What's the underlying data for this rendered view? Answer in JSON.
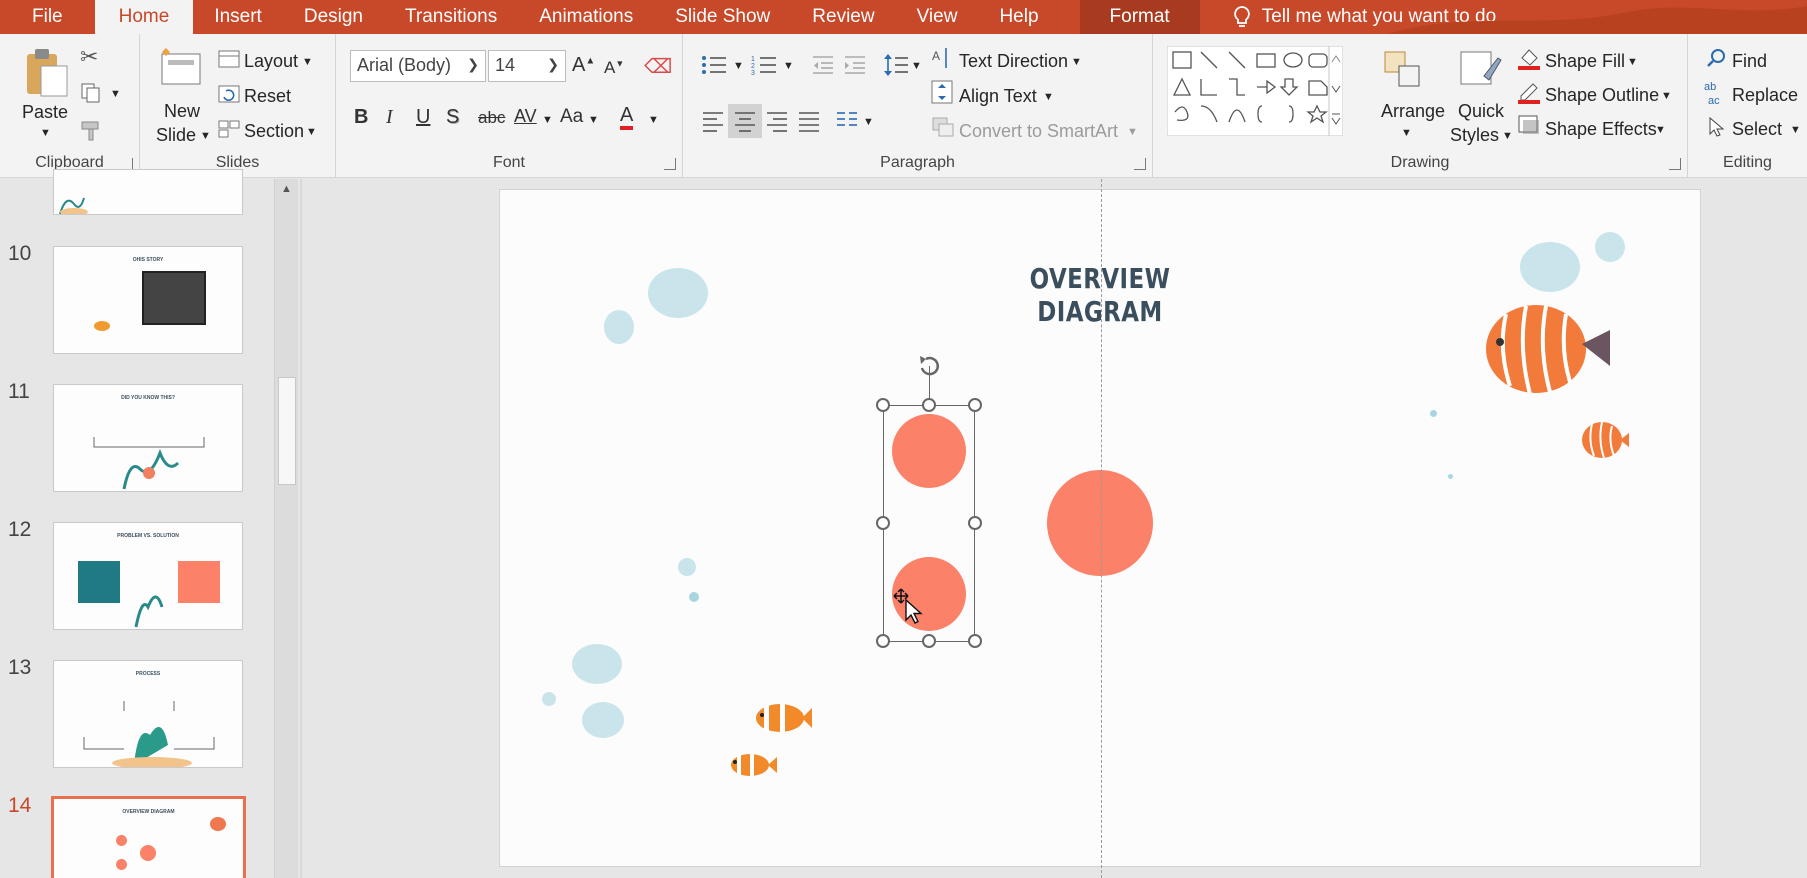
{
  "tabs": [
    "File",
    "Home",
    "Insert",
    "Design",
    "Transitions",
    "Animations",
    "Slide Show",
    "Review",
    "View",
    "Help"
  ],
  "active_tab": "Home",
  "context_tab": "Format",
  "tell_me": "Tell me what you want to do",
  "ribbon": {
    "clipboard": {
      "label": "Clipboard",
      "paste": "Paste"
    },
    "slides": {
      "label": "Slides",
      "new_slide_line1": "New",
      "new_slide_line2": "Slide",
      "layout": "Layout",
      "reset": "Reset",
      "section": "Section"
    },
    "font": {
      "label": "Font",
      "font_name": "Arial (Body)",
      "font_size": "14",
      "bold": "B",
      "italic": "I",
      "underline": "U",
      "shadow": "S",
      "strike": "abc",
      "spacing": "AV",
      "case": "Aa",
      "color": "A"
    },
    "paragraph": {
      "label": "Paragraph",
      "text_direction": "Text Direction",
      "align_text": "Align Text",
      "convert_smartart": "Convert to SmartArt"
    },
    "drawing": {
      "label": "Drawing",
      "arrange": "Arrange",
      "quick_styles_line1": "Quick",
      "quick_styles_line2": "Styles",
      "shape_fill": "Shape Fill",
      "shape_outline": "Shape Outline",
      "shape_effects": "Shape Effects"
    },
    "editing": {
      "label": "Editing",
      "find": "Find",
      "replace": "Replace",
      "select": "Select"
    }
  },
  "thumbnails": [
    {
      "number": "10",
      "title": "OHIS STORY"
    },
    {
      "number": "11",
      "title": "DID YOU KNOW THIS?"
    },
    {
      "number": "12",
      "title": "PROBLEM VS. SOLUTION"
    },
    {
      "number": "13",
      "title": "PROCESS"
    },
    {
      "number": "14",
      "title": "OVERVIEW DIAGRAM"
    }
  ],
  "current_slide": "14",
  "slide": {
    "title": "OVERVIEW DIAGRAM"
  },
  "colors": {
    "accent": "#c8482a",
    "circle": "#fb8168",
    "title": "#3a4e5e",
    "bubble": "#9fd2dc"
  },
  "icons": [
    "lightbulb-icon",
    "paste-icon",
    "cut-icon",
    "copy-icon",
    "format-painter-icon",
    "new-slide-icon",
    "layout-icon",
    "reset-icon",
    "section-icon",
    "grow-font-icon",
    "shrink-font-icon",
    "clear-format-icon",
    "bullets-icon",
    "numbering-icon",
    "decrease-indent-icon",
    "increase-indent-icon",
    "line-spacing-icon",
    "align-left-icon",
    "align-center-icon",
    "align-right-icon",
    "justify-icon",
    "columns-icon",
    "text-direction-icon",
    "align-text-icon",
    "smartart-icon",
    "shapes-gallery-icon",
    "arrange-icon",
    "quick-styles-icon",
    "shape-fill-icon",
    "shape-outline-icon",
    "shape-effects-icon",
    "find-icon",
    "replace-icon",
    "select-icon",
    "rotate-handle-icon",
    "mouse-cursor-icon"
  ]
}
